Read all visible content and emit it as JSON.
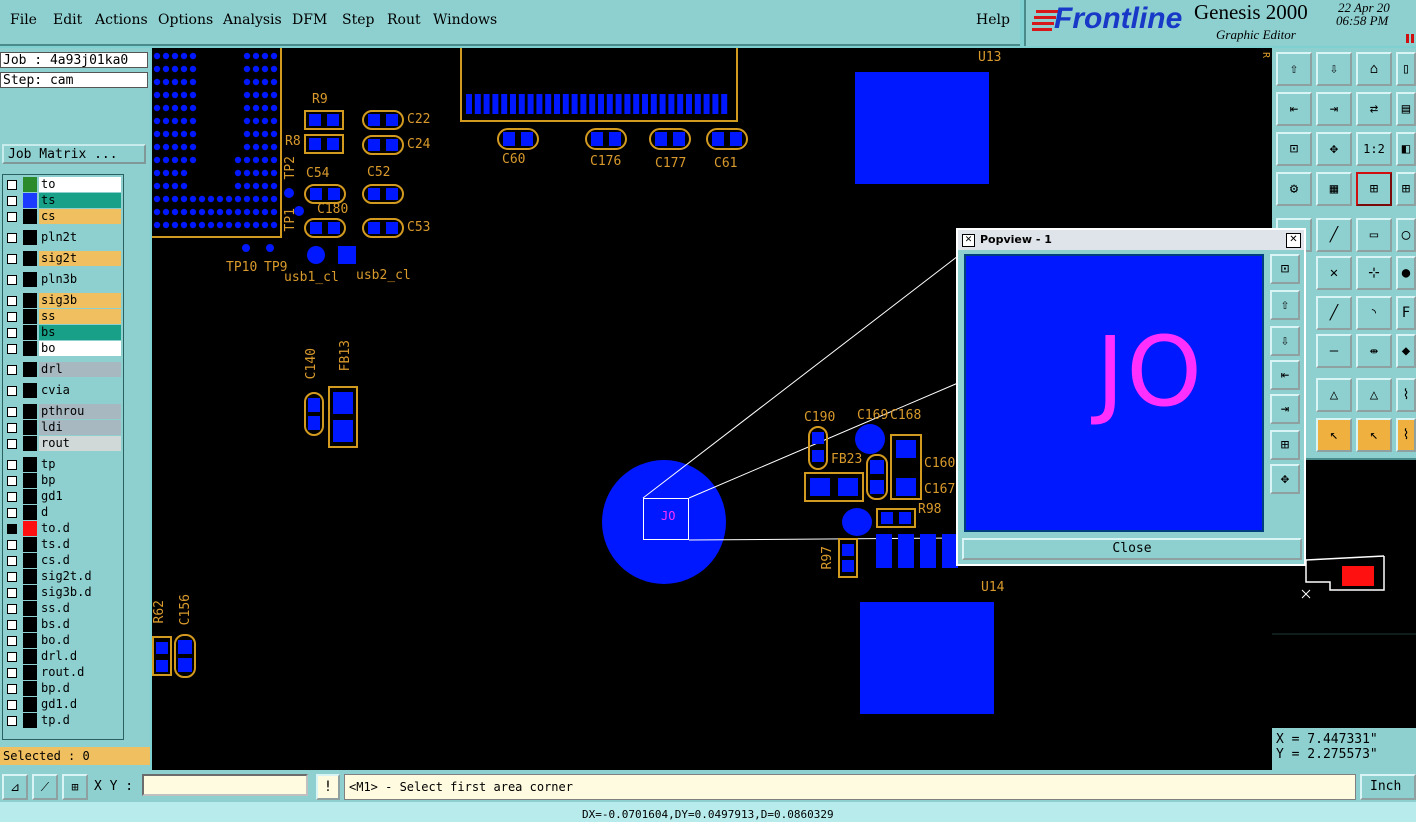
{
  "menu": {
    "file": "File",
    "edit": "Edit",
    "actions": "Actions",
    "options": "Options",
    "analysis": "Analysis",
    "dfm": "DFM",
    "step": "Step",
    "rout": "Rout",
    "windows": "Windows",
    "help": "Help"
  },
  "brand": {
    "logo": "Frontline",
    "product": "Genesis 2000",
    "subtitle": "Graphic Editor",
    "date": "22 Apr 20",
    "time": "06:58 PM"
  },
  "job": {
    "job_label": "Job : 4a93j01ka0",
    "step_label": "Step: cam",
    "job_matrix": "Job Matrix ..."
  },
  "layers": [
    {
      "name": "to",
      "bg": "#ffffff",
      "swatch": "#2b8a2b"
    },
    {
      "name": "ts",
      "bg": "#18a088",
      "swatch": "#1b3cff"
    },
    {
      "name": "cs",
      "bg": "#f0c060",
      "swatch": "#000000"
    },
    {
      "name": "pln2t",
      "bg": "#8ecfcf",
      "swatch": "#000000"
    },
    {
      "name": "sig2t",
      "bg": "#f0c060",
      "swatch": "#000000"
    },
    {
      "name": "pln3b",
      "bg": "#8ecfcf",
      "swatch": "#000000"
    },
    {
      "name": "sig3b",
      "bg": "#f0c060",
      "swatch": "#000000"
    },
    {
      "name": "ss",
      "bg": "#f0c060",
      "swatch": "#000000"
    },
    {
      "name": "bs",
      "bg": "#18a088",
      "swatch": "#000000"
    },
    {
      "name": "bo",
      "bg": "#ffffff",
      "swatch": "#000000"
    },
    {
      "name": "drl",
      "bg": "#a8b8c0",
      "swatch": "#000000"
    },
    {
      "name": "cvia",
      "bg": "#8ecfcf",
      "swatch": "#000000"
    },
    {
      "name": "pthrou",
      "bg": "#a8b8c0",
      "swatch": "#000000"
    },
    {
      "name": "ldi",
      "bg": "#a8b8c0",
      "swatch": "#000000"
    },
    {
      "name": "rout",
      "bg": "#d0d8d8",
      "swatch": "#000000"
    },
    {
      "name": "tp",
      "bg": "#8ecfcf",
      "swatch": "#000000"
    },
    {
      "name": "bp",
      "bg": "#8ecfcf",
      "swatch": "#000000"
    },
    {
      "name": "gd1",
      "bg": "#8ecfcf",
      "swatch": "#000000"
    },
    {
      "name": "d",
      "bg": "#8ecfcf",
      "swatch": "#000000"
    },
    {
      "name": "to.d",
      "bg": "#8ecfcf",
      "swatch": "#ff1010"
    },
    {
      "name": "ts.d",
      "bg": "#8ecfcf",
      "swatch": "#000000"
    },
    {
      "name": "cs.d",
      "bg": "#8ecfcf",
      "swatch": "#000000"
    },
    {
      "name": "sig2t.d",
      "bg": "#8ecfcf",
      "swatch": "#000000"
    },
    {
      "name": "sig3b.d",
      "bg": "#8ecfcf",
      "swatch": "#000000"
    },
    {
      "name": "ss.d",
      "bg": "#8ecfcf",
      "swatch": "#000000"
    },
    {
      "name": "bs.d",
      "bg": "#8ecfcf",
      "swatch": "#000000"
    },
    {
      "name": "bo.d",
      "bg": "#8ecfcf",
      "swatch": "#000000"
    },
    {
      "name": "drl.d",
      "bg": "#8ecfcf",
      "swatch": "#000000"
    },
    {
      "name": "rout.d",
      "bg": "#8ecfcf",
      "swatch": "#000000"
    },
    {
      "name": "bp.d",
      "bg": "#8ecfcf",
      "swatch": "#000000"
    },
    {
      "name": "gd1.d",
      "bg": "#8ecfcf",
      "swatch": "#000000"
    },
    {
      "name": "tp.d",
      "bg": "#8ecfcf",
      "swatch": "#000000"
    }
  ],
  "selected": "Selected : 0",
  "designators": {
    "r9": "R9",
    "r8": "R8",
    "tp2": "TP2",
    "tp1": "TP1",
    "tp10": "TP10",
    "tp9": "TP9",
    "usb1": "usb1_cl",
    "usb2": "usb2_cl",
    "c22": "C22",
    "c24": "C24",
    "c54": "C54",
    "c52": "C52",
    "c180": "C180",
    "c53": "C53",
    "c60": "C60",
    "c176": "C176",
    "c177": "C177",
    "c61": "C61",
    "u13": "U13",
    "c140": "C140",
    "fb13": "FB13",
    "c190": "C190",
    "c169": "C169",
    "c168": "C168",
    "fb23": "FB23",
    "c160": "C160",
    "c167": "C167",
    "r98": "R98",
    "r97": "R97",
    "u14": "U14",
    "r62": "R62",
    "c156": "C156",
    "jo": "JO",
    "edge": "R"
  },
  "popview": {
    "title": "Popview - 1",
    "zoom_text": "JO",
    "close": "Close"
  },
  "coords": {
    "x": "X = 7.447331\"",
    "y": "Y = 2.275573\""
  },
  "bottom": {
    "xy_label": "X Y :",
    "xy_placeholder": "",
    "prompt": "<M1> - Select first area corner",
    "unit": "Inch"
  },
  "status": "DX=-0.0701604,DY=0.0497913,D=0.0860329"
}
